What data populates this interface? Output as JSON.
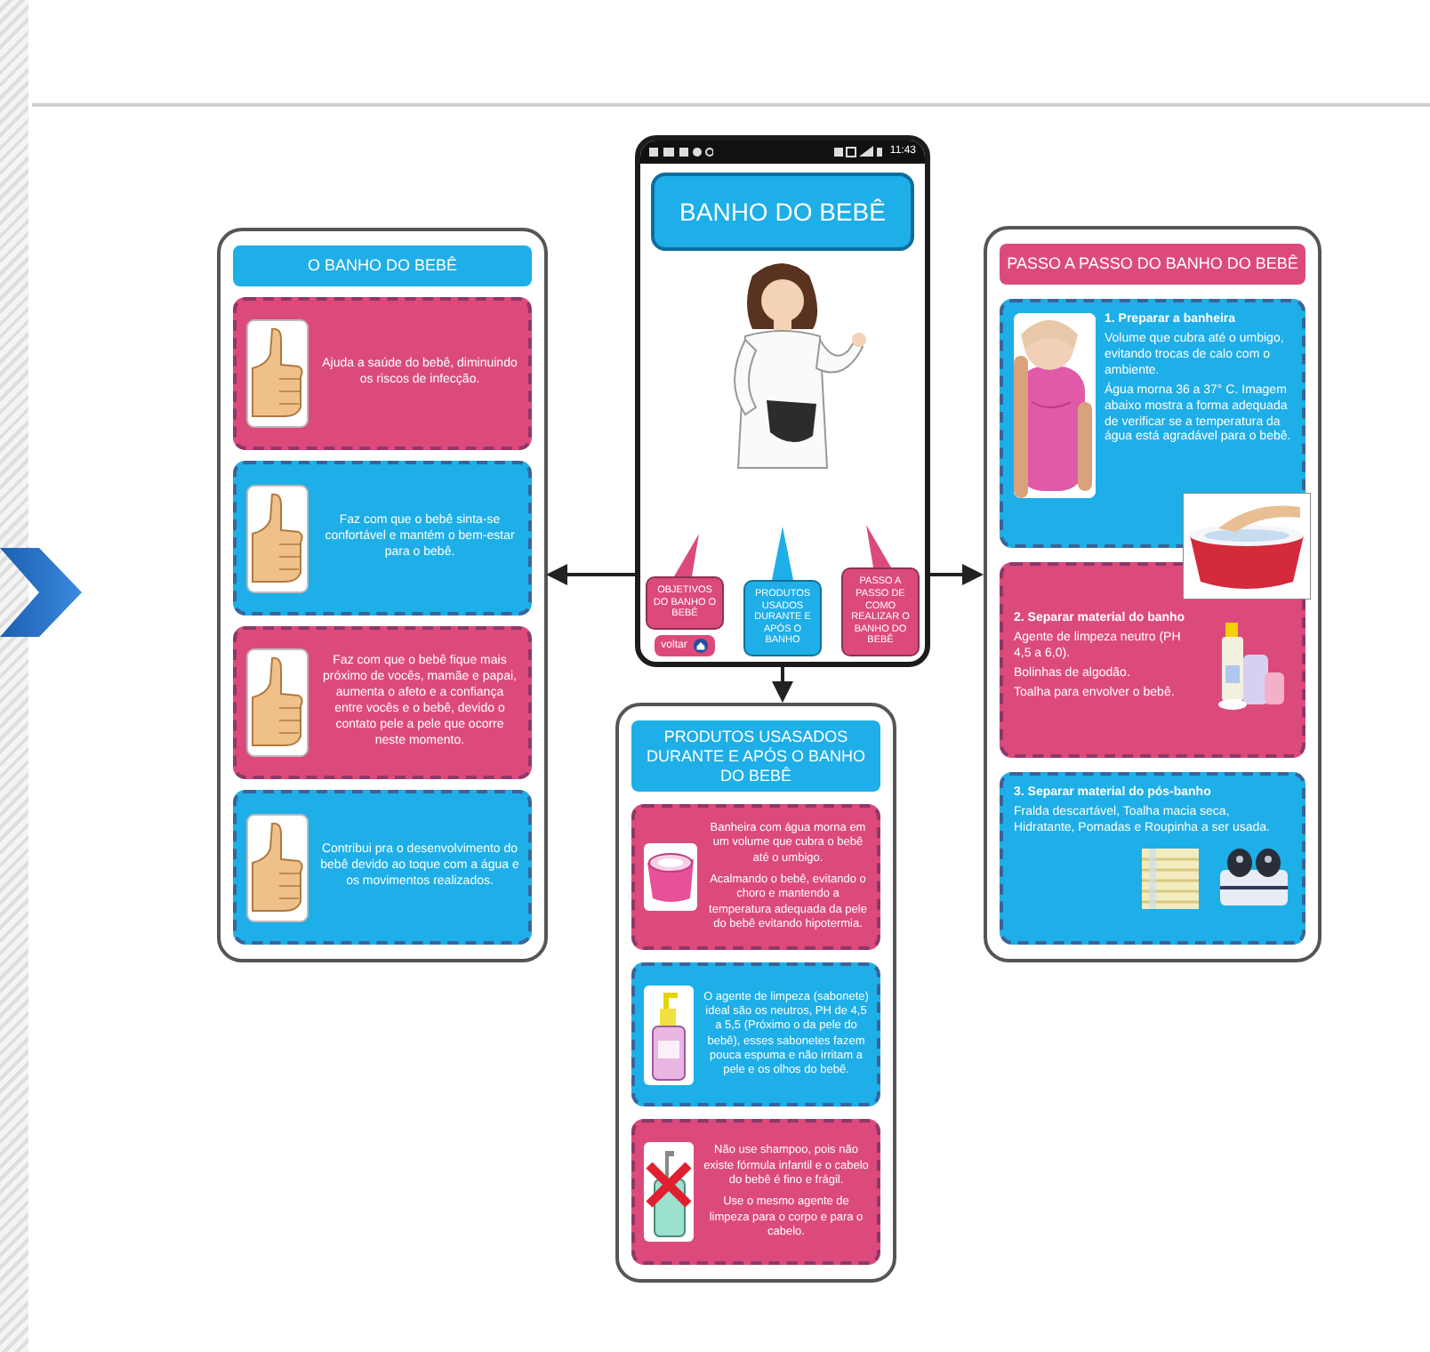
{
  "left_panel": {
    "title": "O BANHO DO BEBÊ",
    "cards": [
      {
        "kind": "thumb",
        "color": "#dc4a7b",
        "text": "Ajuda a saúde do bebê, diminuindo os riscos de infecção."
      },
      {
        "kind": "thumb",
        "color": "#1eaee8",
        "text": "Faz com que o bebê sinta-se confortável e mantém o bem-estar para o bebê."
      },
      {
        "kind": "thumb",
        "color": "#dc4a7b",
        "text": "Faz com que o bebê fique mais próximo de vocês, mamãe e papai, aumenta o afeto e a confiança entre vocês e o bebê, devido o contato pele a pele que ocorre neste momento."
      },
      {
        "kind": "thumb",
        "color": "#1eaee8",
        "text": "Contribui pra o desenvolvimento do bebê devido ao toque com a água e os movimentos realizados."
      }
    ]
  },
  "phone": {
    "status_time": "11:43",
    "title": "BANHO DO BEBÊ",
    "bubbles": [
      {
        "text": "OBJETIVOS DO BANHO O BEBÊ",
        "color": "#dc4a7b"
      },
      {
        "text": "PRODUTOS USADOS DURANTE E APÓS O BANHO",
        "color": "#1eaee8"
      },
      {
        "text": "PASSO A PASSO DE COMO REALIZAR O BANHO DO BEBÊ",
        "color": "#dc4a7b"
      }
    ],
    "back_label": "voltar"
  },
  "products_panel": {
    "title": "PRODUTOS USASADOS DURANTE E APÓS O BANHO DO BEBÊ",
    "cards": [
      {
        "kind": "tub",
        "color": "#dc4a7b",
        "paragraphs": [
          "Banheira com água morna em um volume que cubra o bebê até o umbigo.",
          "Acalmando o bebê, evitando o choro e mantendo a temperatura adequada da pele do bebê evitando hipotermia."
        ]
      },
      {
        "kind": "bottle",
        "color": "#1eaee8",
        "paragraphs": [
          "O agente de limpeza (sabonete) ideal são os neutros, PH de 4,5 a 5,5 (Próximo o da pele do bebê), esses sabonetes fazem pouca espuma e não irritam a pele e os olhos do bebê."
        ]
      },
      {
        "kind": "crossed-bottle",
        "color": "#dc4a7b",
        "paragraphs": [
          "Não use shampoo, pois não existe fórmula infantil e o cabelo do bebê é fino e frágil.",
          "Use o mesmo agente de limpeza para o corpo e para o cabelo."
        ]
      }
    ]
  },
  "steps_panel": {
    "title": "PASSO A PASSO DO BANHO DO BEBÊ",
    "steps": [
      {
        "color": "#1eaee8",
        "heading": "1. Preparar a banheira",
        "lines": [
          "Volume que cubra até o umbigo, evitando trocas de calo com o ambiente.",
          "Água morna 36 a 37° C. Imagem abaixo mostra a forma adequada de verificar se a temperatura da água está agradável para o bebê."
        ]
      },
      {
        "color": "#dc4a7b",
        "heading": "2. Separar material do banho",
        "lines": [
          "Agente de limpeza neutro (PH 4,5 a 6,0).",
          "Bolinhas de algodão.",
          "Toalha para envolver o bebê."
        ]
      },
      {
        "color": "#1eaee8",
        "heading": "3. Separar material do pós-banho",
        "lines": [
          "Fralda descartável, Toalha macia seca, Hidratante, Pomadas e Roupinha a ser usada."
        ]
      }
    ]
  }
}
